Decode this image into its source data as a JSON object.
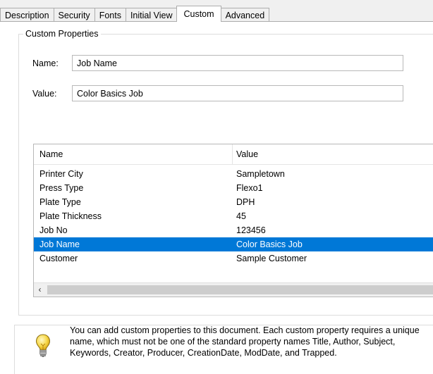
{
  "tabs": [
    {
      "label": "Description",
      "active": false
    },
    {
      "label": "Security",
      "active": false
    },
    {
      "label": "Fonts",
      "active": false
    },
    {
      "label": "Initial View",
      "active": false
    },
    {
      "label": "Custom",
      "active": true
    },
    {
      "label": "Advanced",
      "active": false
    }
  ],
  "group": {
    "title": "Custom Properties"
  },
  "form": {
    "name_label": "Name:",
    "name_value": "Job Name",
    "value_label": "Value:",
    "value_value": "Color Basics Job"
  },
  "list": {
    "columns": [
      "Name",
      "Value"
    ],
    "rows": [
      {
        "name": "Printer City",
        "value": "Sampletown",
        "selected": false
      },
      {
        "name": "Press Type",
        "value": "Flexo1",
        "selected": false
      },
      {
        "name": "Plate Type",
        "value": "DPH",
        "selected": false
      },
      {
        "name": "Plate Thickness",
        "value": "45",
        "selected": false
      },
      {
        "name": "Job No",
        "value": "123456",
        "selected": false
      },
      {
        "name": "Job Name",
        "value": "Color Basics Job",
        "selected": true
      },
      {
        "name": "Customer",
        "value": "Sample Customer",
        "selected": false
      }
    ],
    "scroll_left_glyph": "‹"
  },
  "info": {
    "icon": "lightbulb-icon",
    "text": "You can add custom properties to this document. Each custom property requires a unique name, which must not be one of the standard property names Title, Author, Subject, Keywords, Creator, Producer, CreationDate, ModDate, and Trapped."
  },
  "colors": {
    "selection": "#0078d7",
    "border": "#adadad"
  }
}
